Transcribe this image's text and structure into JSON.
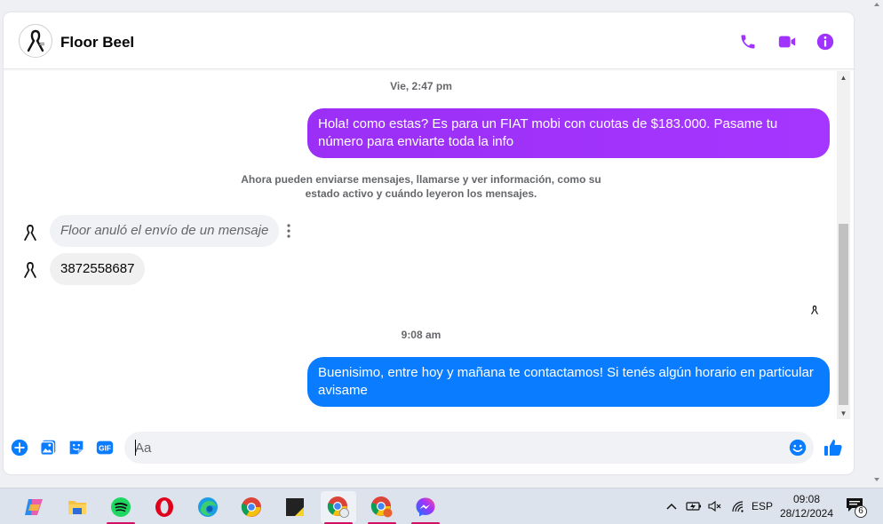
{
  "header": {
    "contact_name": "Floor Beel"
  },
  "messages": {
    "timestamp_1": "Vie, 2:47 pm",
    "outgoing_1": "Hola! como estas? Es para un FIAT mobi con cuotas de $183.000. Pasame tu número para enviarte toda la info",
    "notice": "Ahora pueden enviarse mensajes, llamarse y ver información, como su estado activo y cuándo leyeron los mensajes.",
    "incoming_unsent": "Floor anuló el envío de un mensaje",
    "incoming_2": "3872558687",
    "timestamp_2": "9:08 am",
    "outgoing_2": "Buenisimo, entre hoy y mañana te contactamos! Si tenés algún horario en particular avisame"
  },
  "composer": {
    "placeholder": "Aa",
    "gif_label": "GIF"
  },
  "colors": {
    "accent": "#a033ff",
    "outgoing_blue": "#0a7cff",
    "composer_icon": "#0a7cff",
    "header_icon": "#a033ff"
  },
  "taskbar": {
    "apps": [
      "copilot-icon",
      "file-explorer-icon",
      "spotify-icon",
      "opera-icon",
      "edge-icon",
      "chrome-icon",
      "sticky-notes-icon",
      "chrome-profile-icon",
      "chrome-profile-icon",
      "messenger-icon"
    ],
    "language": "ESP",
    "time": "09:08",
    "date": "28/12/2024",
    "notification_count": "6"
  }
}
